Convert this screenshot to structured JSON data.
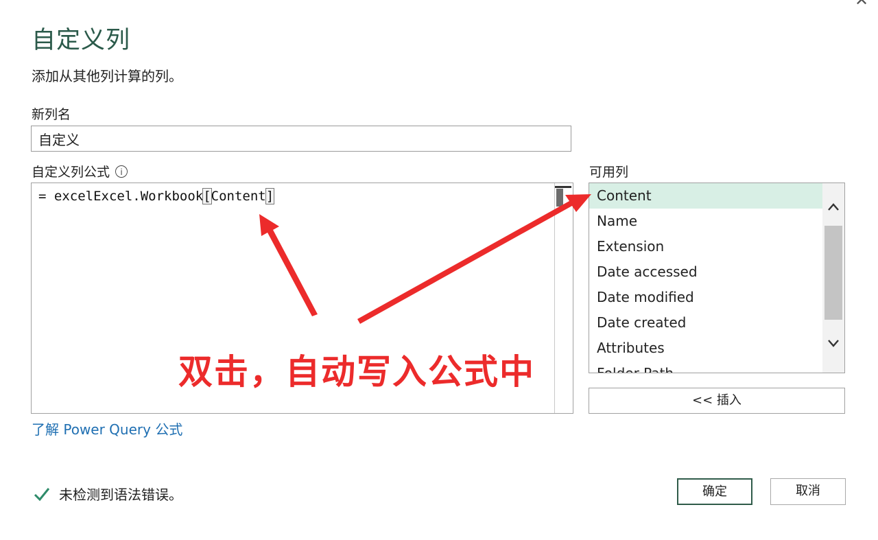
{
  "dialog": {
    "close_glyph": "✕",
    "title": "自定义列",
    "subtitle": "添加从其他列计算的列。",
    "new_column_label": "新列名",
    "new_column_value": "自定义",
    "formula_label": "自定义列公式",
    "info_glyph": "i",
    "formula_text": "= excelExcel.Workbook[Content]",
    "available_label": "可用列",
    "available_columns": [
      "Content",
      "Name",
      "Extension",
      "Date accessed",
      "Date modified",
      "Date created",
      "Attributes",
      "Folder Path"
    ],
    "selected_column": "Content",
    "insert_button": "<< 插入",
    "learn_link": "了解 Power Query 公式",
    "status_text": "未检测到语法错误。",
    "ok_button": "确定",
    "cancel_button": "取消"
  },
  "annotation": {
    "text": "双击，自动写入公式中",
    "color": "#ec2b2b"
  },
  "colors": {
    "accent": "#2b5a4a",
    "selected_row": "#d8efe5",
    "link": "#1f6fb2",
    "check": "#2e8b6a"
  },
  "icons": [
    "close-icon",
    "info-icon",
    "chevron-up-icon",
    "chevron-down-icon",
    "check-icon"
  ]
}
